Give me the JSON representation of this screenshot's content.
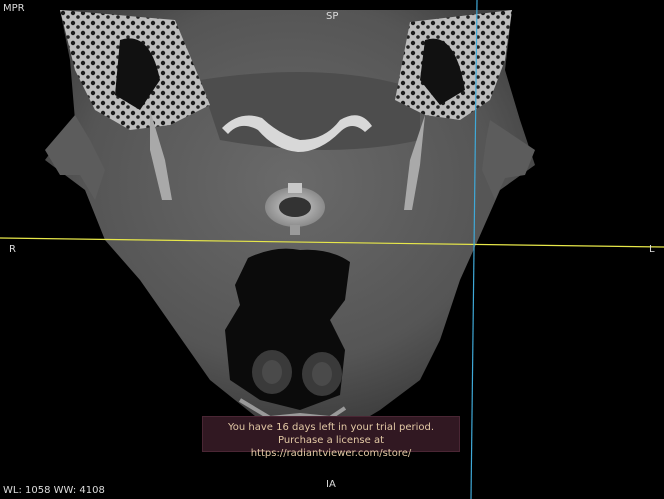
{
  "viewer": {
    "mode": "MPR",
    "orientation": {
      "top": "SP",
      "bottom": "IA",
      "left": "R",
      "right": "L"
    },
    "window_level_text": "WL: 1058 WW: 4108"
  },
  "crosshair": {
    "horizontal_color": "#e8e84a",
    "vertical_color": "#3fa9d8"
  },
  "trial_banner": {
    "line1": "You have 16 days left in your trial period.",
    "line2": "Purchase a license at https://radiantviewer.com/store/"
  }
}
